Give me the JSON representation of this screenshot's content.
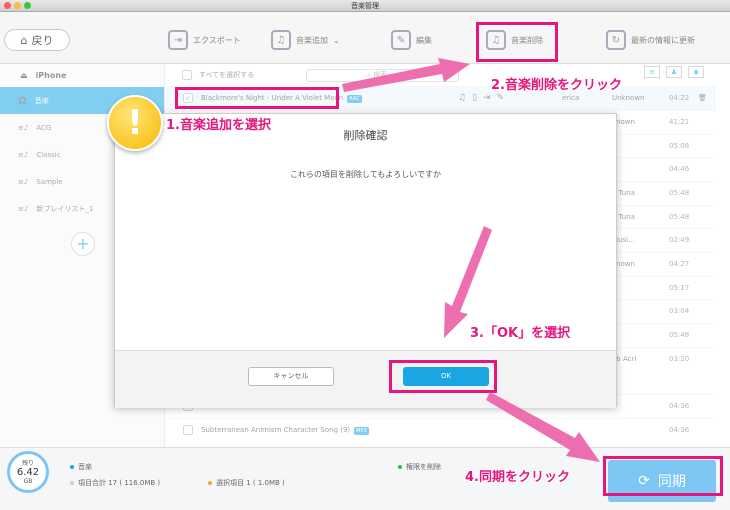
{
  "window": {
    "title": "音楽管理"
  },
  "toolbar": {
    "back_label": "戻り",
    "export_label": "エクスポート",
    "add_label": "音楽追加",
    "edit_label": "編集",
    "delete_label": "音楽削除",
    "refresh_label": "最新の情報に更新"
  },
  "sidebar": {
    "device": "iPhone",
    "items": [
      {
        "label": "音楽"
      },
      {
        "label": "ACG"
      },
      {
        "label": "Classic"
      },
      {
        "label": "Sample"
      },
      {
        "label": "新プレイリスト_1"
      }
    ]
  },
  "list": {
    "select_all_label": "すべてを選択する",
    "search_placeholder": "検索",
    "rows": [
      {
        "name": "Blackmore's Night - Under A Violet Moon",
        "badge": "AAC",
        "artist": "erica",
        "album": "Unknown",
        "duration": "04:22"
      },
      {
        "name": "",
        "badge": "",
        "artist": "",
        "album": "known",
        "duration": "41:21"
      },
      {
        "name": "",
        "badge": "",
        "artist": "",
        "album": "",
        "duration": "05:08"
      },
      {
        "name": "",
        "badge": "",
        "artist": "",
        "album": "",
        "duration": "04:46"
      },
      {
        "name": "",
        "badge": "",
        "artist": "",
        "album": "a Tuna",
        "duration": "05:48"
      },
      {
        "name": "",
        "badge": "",
        "artist": "",
        "album": "a Tuna",
        "duration": "05:48"
      },
      {
        "name": "",
        "badge": "",
        "artist": "",
        "album": "Musi...",
        "duration": "02:49"
      },
      {
        "name": "",
        "badge": "",
        "artist": "",
        "album": "known",
        "duration": "04:27"
      },
      {
        "name": "",
        "badge": "",
        "artist": "",
        "album": "",
        "duration": "05:17"
      },
      {
        "name": "",
        "badge": "",
        "artist": "",
        "album": "",
        "duration": "03:04"
      },
      {
        "name": "",
        "badge": "",
        "artist": "",
        "album": "",
        "duration": "05:48"
      },
      {
        "name": "",
        "badge": "",
        "artist": "",
        "album": "ob Acri",
        "duration": "03:20"
      },
      {
        "name": "",
        "badge": "",
        "artist": "",
        "album": "",
        "duration": "04:36"
      },
      {
        "name": "Subterranean Animism Character Song (9)",
        "badge": "MP3",
        "artist": "",
        "album": "",
        "duration": "04:36"
      }
    ]
  },
  "dialog": {
    "title": "削除確認",
    "message": "これらの項目を削除してもよろしいですか",
    "cancel_label": "キャンセル",
    "ok_label": "OK"
  },
  "footer": {
    "gauge_top": "残り",
    "gauge_value": "6.42",
    "gauge_unit": "GB",
    "legend_music": "音楽",
    "legend_delete": "権限を削除",
    "total_label": "項目合計 17 ( 116.0MB )",
    "selected_label": "選択項目 1 ( 1.0MB )",
    "sync_label": "同期"
  },
  "annotations": {
    "step1": "1.音楽追加を選択",
    "step2": "2.音楽削除をクリック",
    "step3": "3.「OK」を選択",
    "step4": "4.同期をクリック"
  },
  "colors": {
    "accent": "#19a6e3",
    "annotation": "#e5177e"
  }
}
